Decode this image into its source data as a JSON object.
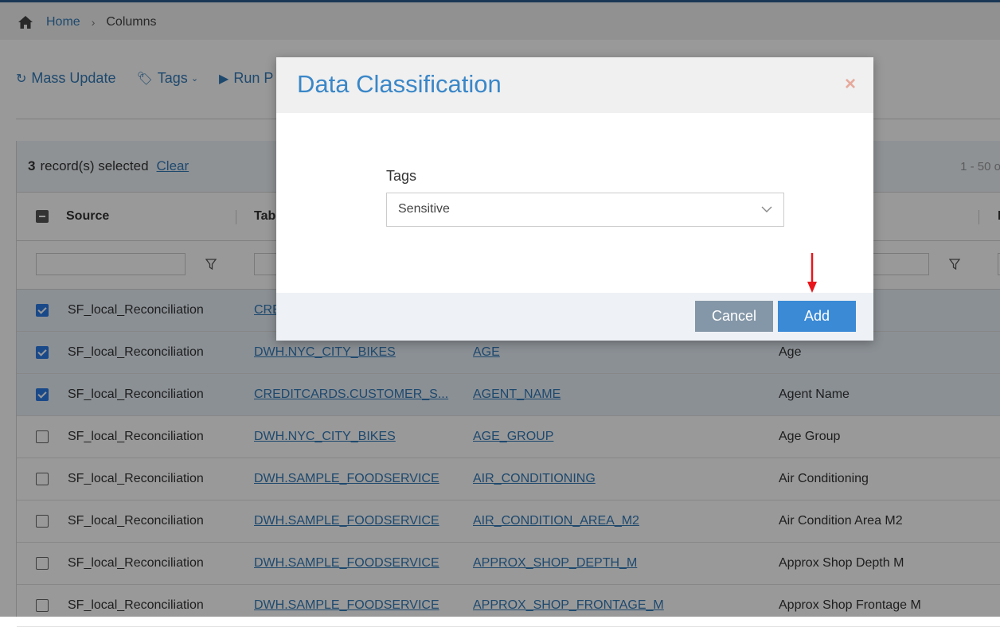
{
  "breadcrumb": {
    "home": "Home",
    "separator": "›",
    "current": "Columns"
  },
  "toolbar": {
    "mass_update": "Mass Update",
    "tags": "Tags",
    "run": "Run P"
  },
  "selection": {
    "count": "3",
    "text": "record(s) selected",
    "clear": "Clear",
    "pager": "1 - 50 o"
  },
  "grid": {
    "headers": {
      "source": "Source",
      "table": "Tab",
      "extra": "D"
    },
    "rows": [
      {
        "checked": true,
        "source": "SF_local_Reconciliation",
        "table": "CRE",
        "column": "",
        "label": ""
      },
      {
        "checked": true,
        "source": "SF_local_Reconciliation",
        "table": "DWH.NYC_CITY_BIKES",
        "column": "AGE",
        "label": "Age"
      },
      {
        "checked": true,
        "source": "SF_local_Reconciliation",
        "table": "CREDITCARDS.CUSTOMER_S...",
        "column": "AGENT_NAME",
        "label": "Agent Name"
      },
      {
        "checked": false,
        "source": "SF_local_Reconciliation",
        "table": "DWH.NYC_CITY_BIKES",
        "column": "AGE_GROUP",
        "label": "Age Group"
      },
      {
        "checked": false,
        "source": "SF_local_Reconciliation",
        "table": "DWH.SAMPLE_FOODSERVICE",
        "column": "AIR_CONDITIONING",
        "label": "Air Conditioning"
      },
      {
        "checked": false,
        "source": "SF_local_Reconciliation",
        "table": "DWH.SAMPLE_FOODSERVICE",
        "column": "AIR_CONDITION_AREA_M2",
        "label": "Air Condition Area M2"
      },
      {
        "checked": false,
        "source": "SF_local_Reconciliation",
        "table": "DWH.SAMPLE_FOODSERVICE",
        "column": "APPROX_SHOP_DEPTH_M",
        "label": "Approx Shop Depth M"
      },
      {
        "checked": false,
        "source": "SF_local_Reconciliation",
        "table": "DWH.SAMPLE_FOODSERVICE",
        "column": "APPROX_SHOP_FRONTAGE_M",
        "label": "Approx Shop Frontage M"
      }
    ]
  },
  "modal": {
    "title": "Data Classification",
    "close": "×",
    "field_label": "Tags",
    "selected_value": "Sensitive",
    "cancel": "Cancel",
    "add": "Add"
  },
  "colors": {
    "accent": "#337ab7",
    "arrow": "#e8161b",
    "add_button": "#3a8ad6",
    "cancel_button": "#8497a8"
  }
}
